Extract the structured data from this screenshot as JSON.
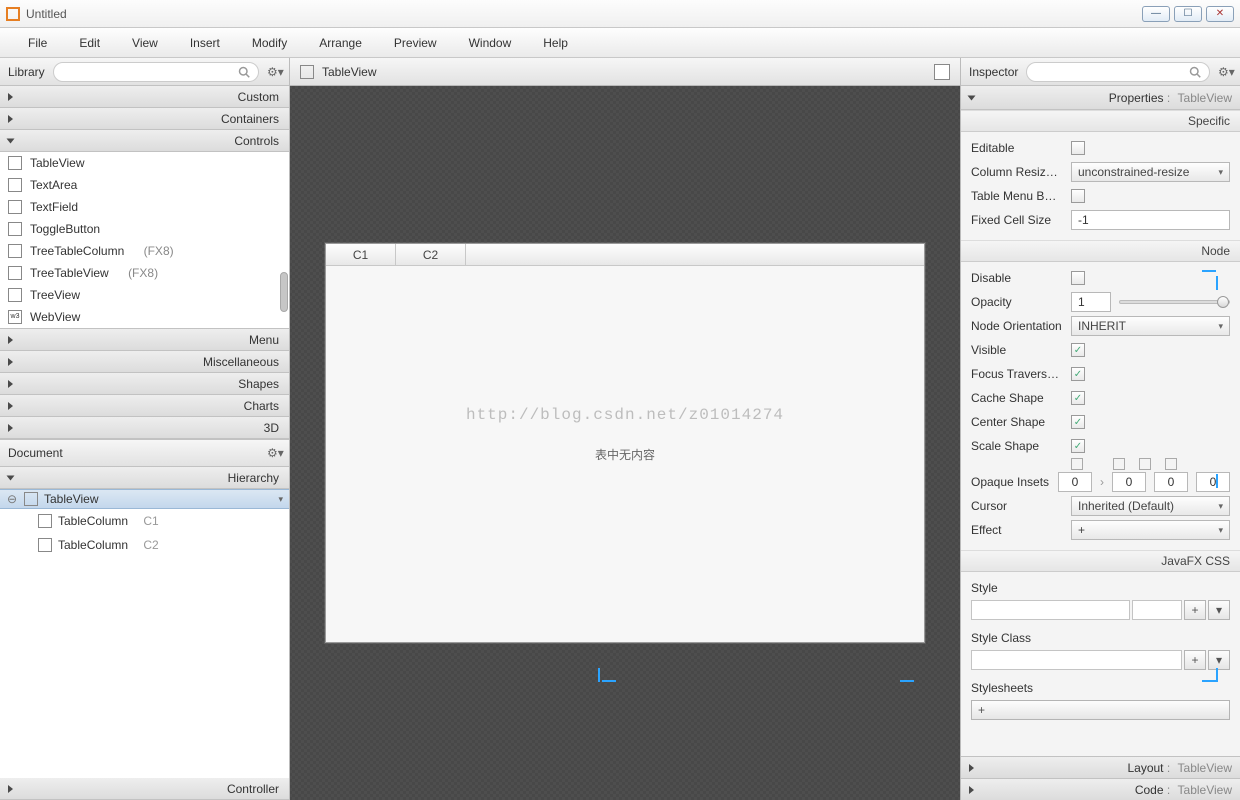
{
  "window": {
    "title": "Untitled"
  },
  "menu": [
    "File",
    "Edit",
    "View",
    "Insert",
    "Modify",
    "Arrange",
    "Preview",
    "Window",
    "Help"
  ],
  "library": {
    "title": "Library",
    "sections_top": [
      "Custom",
      "Containers"
    ],
    "section_open": "Controls",
    "items": [
      {
        "label": "TableView",
        "suffix": ""
      },
      {
        "label": "TextArea",
        "suffix": ""
      },
      {
        "label": "TextField",
        "suffix": ""
      },
      {
        "label": "ToggleButton",
        "suffix": ""
      },
      {
        "label": "TreeTableColumn",
        "suffix": "(FX8)"
      },
      {
        "label": "TreeTableView",
        "suffix": "(FX8)"
      },
      {
        "label": "TreeView",
        "suffix": ""
      },
      {
        "label": "WebView",
        "suffix": ""
      }
    ],
    "sections_bottom": [
      "Menu",
      "Miscellaneous",
      "Shapes",
      "Charts",
      "3D"
    ]
  },
  "document": {
    "title": "Document",
    "section": "Hierarchy",
    "root": "TableView",
    "children": [
      {
        "name": "TableColumn",
        "sub": "C1"
      },
      {
        "name": "TableColumn",
        "sub": "C2"
      }
    ],
    "controller": "Controller"
  },
  "canvas": {
    "breadcrumb": "TableView",
    "columns": [
      "C1",
      "C2"
    ],
    "empty_text": "表中无内容",
    "watermark": "http://blog.csdn.net/z01014274"
  },
  "inspector": {
    "title": "Inspector",
    "header": {
      "label": "Properties",
      "suffix": "TableView"
    },
    "specific": {
      "title": "Specific",
      "editable": false,
      "column_resize_label": "Column Resiz…",
      "column_resize_value": "unconstrained-resize",
      "table_menu_label": "Table Menu B…",
      "table_menu": false,
      "fixed_cell_label": "Fixed Cell Size",
      "fixed_cell_value": "-1"
    },
    "node": {
      "title": "Node",
      "disable": false,
      "opacity": "1",
      "orientation_label": "Node Orientation",
      "orientation": "INHERIT",
      "visible": true,
      "focus_label": "Focus Travers…",
      "focus": true,
      "cache_shape": true,
      "center_shape": true,
      "scale_shape": true,
      "opaque_label": "Opaque Insets",
      "opaque": [
        "0",
        "0",
        "0",
        "0"
      ],
      "cursor_label": "Cursor",
      "cursor": "Inherited (Default)",
      "effect_label": "Effect",
      "effect": "+"
    },
    "css": {
      "title": "JavaFX CSS",
      "style_label": "Style",
      "styleclass_label": "Style Class",
      "stylesheets_label": "Stylesheets"
    },
    "layout": {
      "label": "Layout",
      "suffix": "TableView"
    },
    "code": {
      "label": "Code",
      "suffix": "TableView"
    }
  }
}
